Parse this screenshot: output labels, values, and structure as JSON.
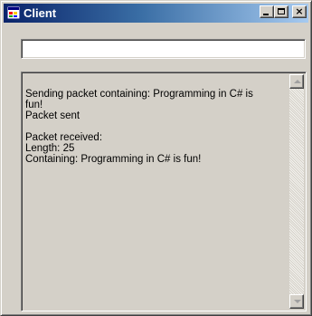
{
  "window": {
    "title": "Client",
    "icon": "app-window-icon",
    "buttons": {
      "minimize": "minimize-icon",
      "maximize": "maximize-icon",
      "close_label": "×"
    }
  },
  "input": {
    "value": "",
    "placeholder": ""
  },
  "log": {
    "lines": [
      "Sending packet containing: Programming in C# is",
      "fun!",
      "Packet sent",
      "",
      "Packet received:",
      "Length: 25",
      "Containing: Programming in C# is fun!"
    ]
  },
  "colors": {
    "face": "#d4d0c8",
    "title_active": "#0a246a",
    "title_gradient_end": "#a6caf0"
  }
}
